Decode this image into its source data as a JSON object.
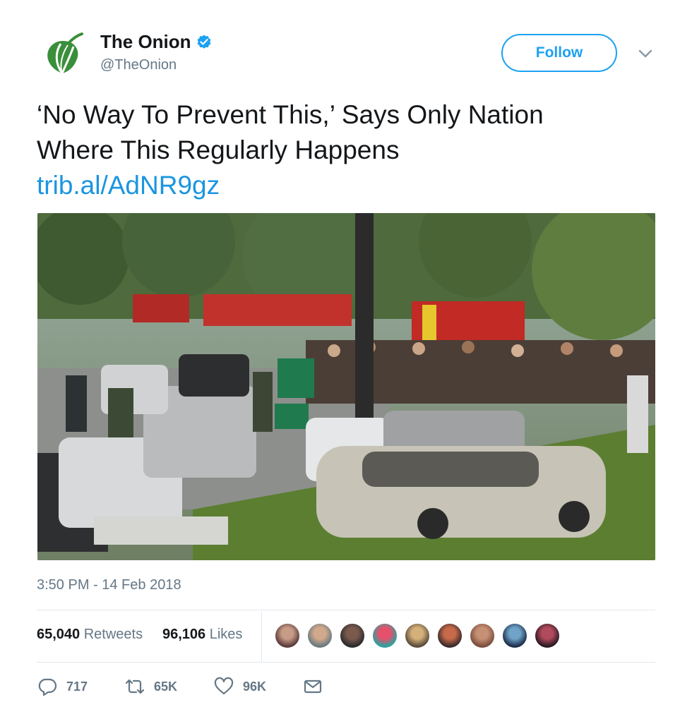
{
  "account": {
    "display_name": "The Onion",
    "handle": "@TheOnion",
    "brand_color": "#3a8f3b",
    "verified_color": "#1da1f2"
  },
  "follow": {
    "label": "Follow"
  },
  "tweet": {
    "text_line1": "‘No Way To Prevent This,’ Says Only Nation",
    "text_line2": "Where This Regularly Happens",
    "link": "trib.al/AdNR9gz",
    "timestamp": "3:50 PM - 14 Feb 2018"
  },
  "stats": {
    "retweets_count": "65,040",
    "retweets_label": "Retweets",
    "likes_count": "96,106",
    "likes_label": "Likes"
  },
  "actions": {
    "reply_count": "717",
    "retweet_count": "65K",
    "like_count": "96K"
  },
  "icons": {
    "chevron": "chevron-down-icon",
    "reply": "reply-icon",
    "retweet": "retweet-icon",
    "like": "heart-icon",
    "message": "envelope-icon"
  }
}
